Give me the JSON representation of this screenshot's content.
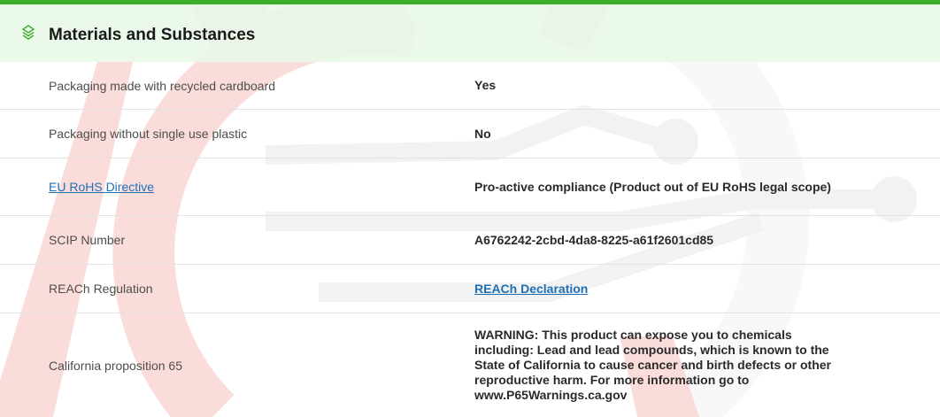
{
  "section": {
    "title": "Materials and Substances",
    "icon": "leaf-layers-icon"
  },
  "rows": [
    {
      "label": "Packaging made with recycled cardboard",
      "value": "Yes"
    },
    {
      "label": "Packaging without single use plastic",
      "value": "No"
    },
    {
      "label": "EU RoHS Directive",
      "value": "Pro-active compliance (Product out of EU RoHS legal scope)"
    },
    {
      "label": "SCIP Number",
      "value": "A6762242-2cbd-4da8-8225-a61f2601cd85"
    },
    {
      "label": "REACh Regulation",
      "value": "REACh Declaration"
    },
    {
      "label": "California proposition 65",
      "value": "WARNING: This product can expose you to chemicals including: Lead and lead compounds, which is known to the State of California to cause cancer and birth defects or other reproductive harm. For more information go to www.P65Warnings.ca.gov"
    }
  ],
  "colors": {
    "accent": "#3dae2b",
    "link": "#1f6fb5",
    "watermark_red": "#e8473a",
    "watermark_gray": "#d9d9d9"
  }
}
